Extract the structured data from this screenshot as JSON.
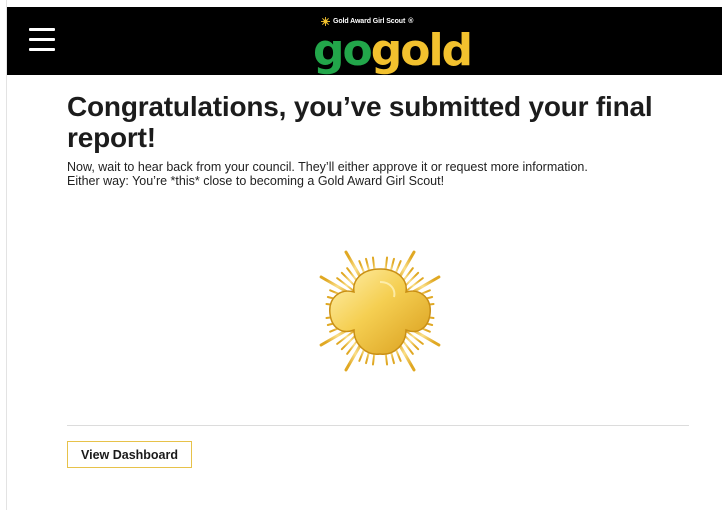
{
  "header": {
    "menu_icon": "hamburger-menu-icon",
    "logo": {
      "tagline": "Gold Award Girl Scout",
      "tagline_mark": "®",
      "word_go": "go",
      "word_gold": "gold",
      "colors": {
        "go": "#22a64a",
        "gold": "#f2c12e",
        "bar": "#000000"
      }
    }
  },
  "main": {
    "title": "Congratulations, you’ve submitted your final report!",
    "subtitle_line1": "Now, wait to hear back from your council.  They’ll either approve it or request more information.",
    "subtitle_line2": "Either way: You’re *this* close to becoming a Gold Award Girl Scout!",
    "emblem_icon": "gold-award-trefoil-icon",
    "dashboard_button_label": "View Dashboard",
    "accent_color": "#e7c24a"
  }
}
